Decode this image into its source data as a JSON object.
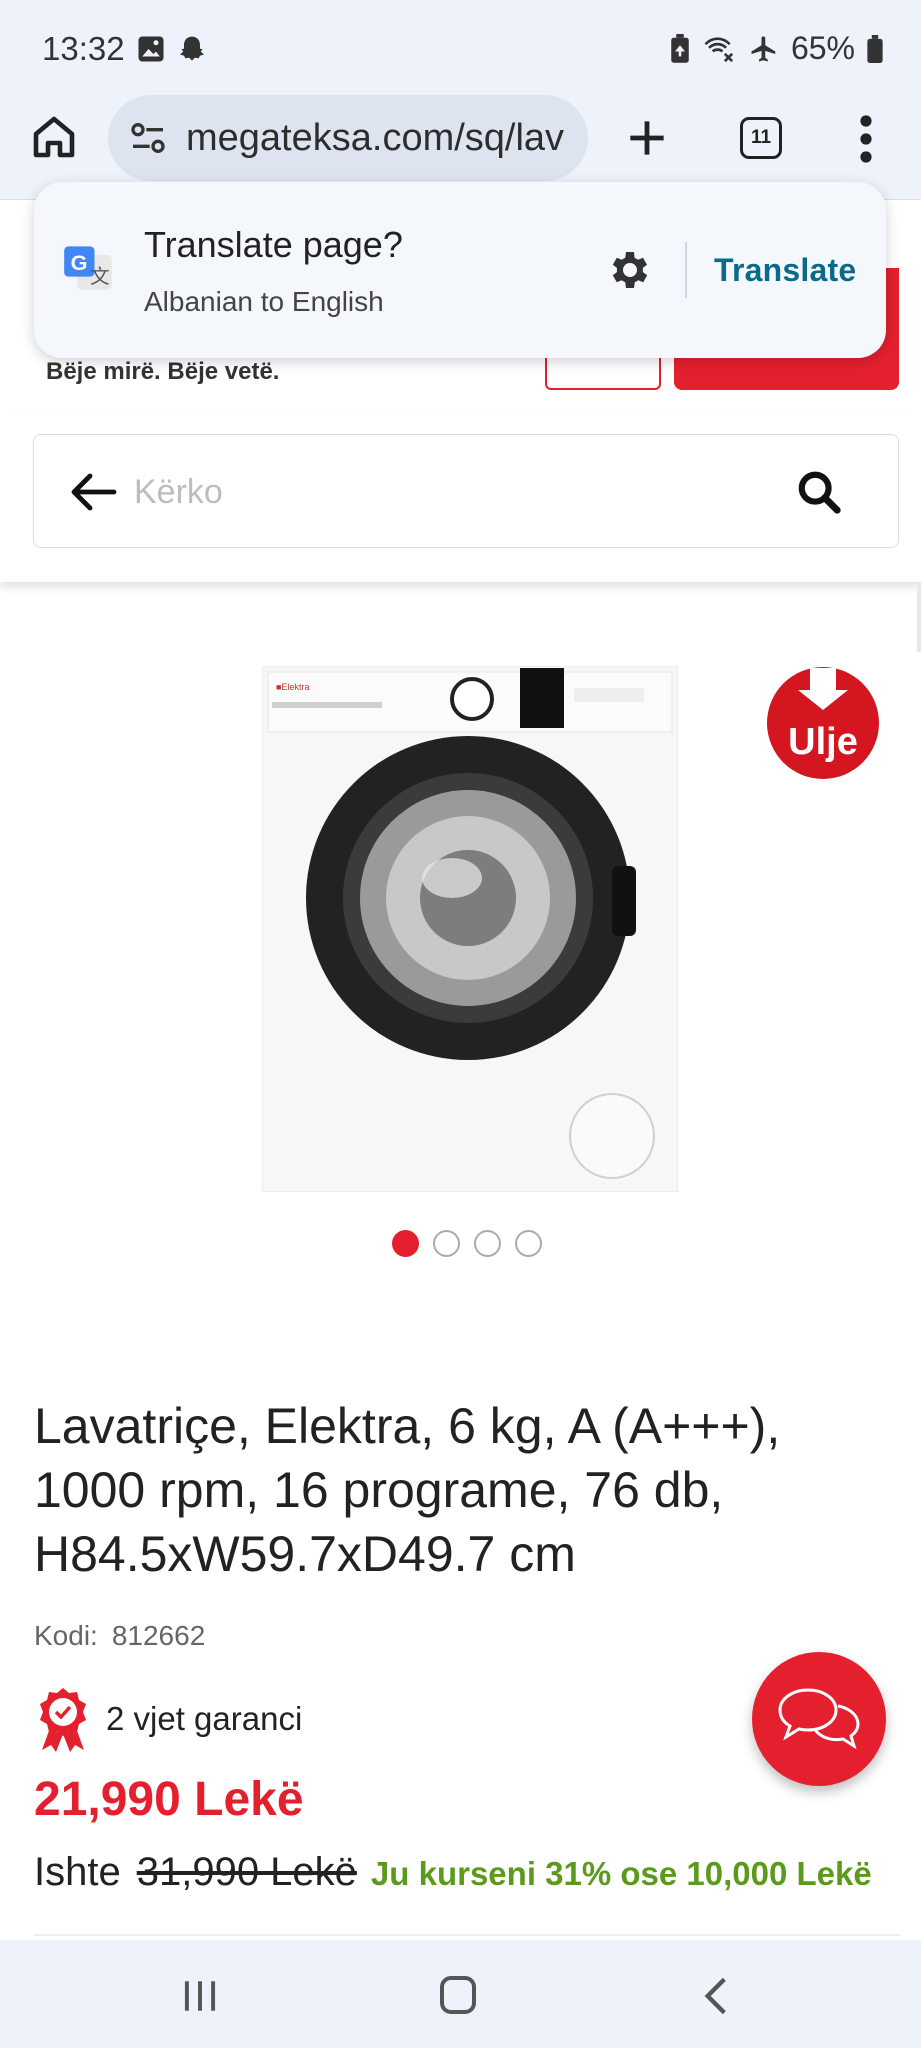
{
  "status_bar": {
    "time": "13:32",
    "battery": "65%",
    "icons": [
      "gallery-icon",
      "snapchat-icon",
      "battery-saver-icon",
      "wifi-calling-icon",
      "airplane-mode-icon",
      "battery-icon"
    ]
  },
  "browser": {
    "url": "megateksa.com/sq/lav",
    "tab_count": "11"
  },
  "translate_popup": {
    "title": "Translate page?",
    "subtitle": "Albanian to English",
    "action_label": "Translate"
  },
  "header": {
    "tagline": "Bëje mirë. Bëje vetë."
  },
  "search": {
    "placeholder": "Kërko"
  },
  "product": {
    "badge_text": "Ulje",
    "image_count": 4,
    "active_image": 1,
    "title": "Lavatriçe, Elektra, 6 kg, A (A+++), 1000 rpm, 16 programe, 76 db, H84.5xW59.7xD49.7 cm",
    "sku_label": "Kodi:",
    "sku_value": "812662",
    "warranty": "2 vjet garanci",
    "price": "21,990 Lekë",
    "was_label": "Ishte",
    "old_price": "31,990 Lekë",
    "savings": "Ju kurseni 31% ose 10,000 Lekë"
  },
  "colors": {
    "brand_red": "#e5202e",
    "savings_green": "#5c9a1c",
    "link_teal": "#0b6a8a",
    "chrome_bg": "#edf2fb"
  }
}
